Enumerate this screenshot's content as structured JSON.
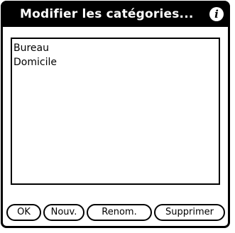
{
  "dialog": {
    "title": "Modifier les catégories...",
    "info_icon": "info-icon"
  },
  "categories": {
    "items": [
      "Bureau",
      "Domicile"
    ]
  },
  "buttons": {
    "ok": "OK",
    "new": "Nouv.",
    "rename": "Renom.",
    "delete": "Supprimer"
  }
}
